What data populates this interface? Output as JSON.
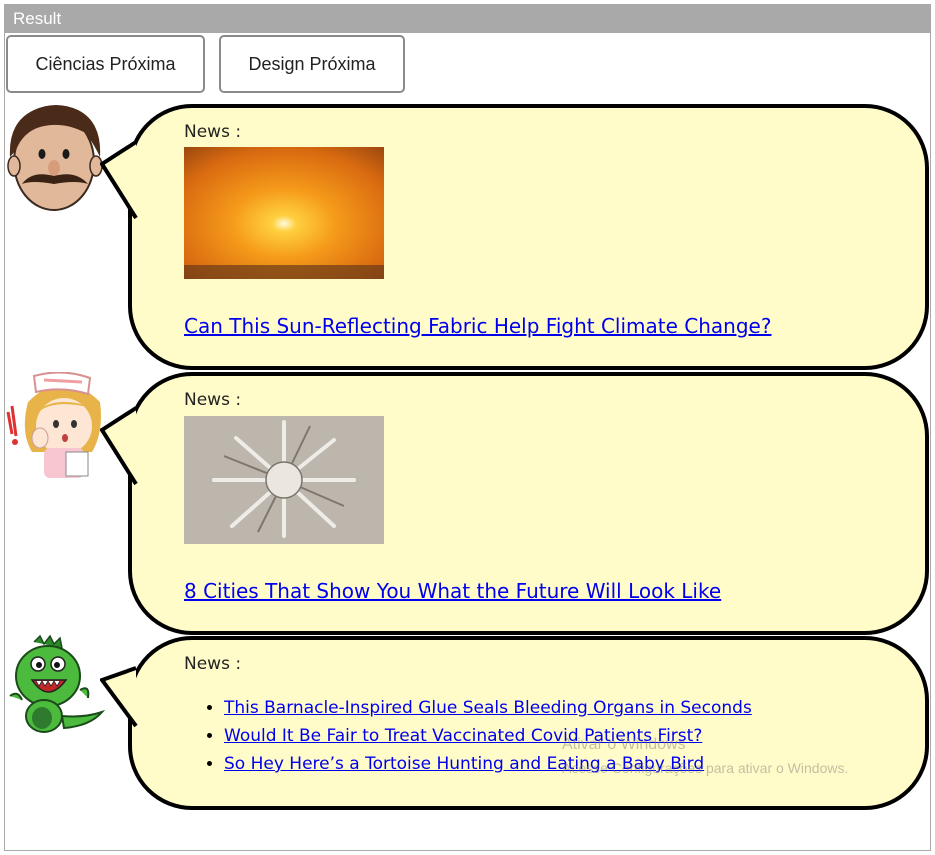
{
  "header": {
    "title": "Result"
  },
  "buttons": {
    "ciencias": "Ciências Próxima",
    "design": "Design Próxima"
  },
  "bubbles": [
    {
      "label": "News :",
      "image": "sunset-photo",
      "headline": "Can This Sun-Reflecting Fabric Help Fight Climate Change?"
    },
    {
      "label": "News :",
      "image": "futuristic-city-model-photo",
      "headline": "8 Cities That Show You What the Future Will Look Like"
    },
    {
      "label": "News :",
      "links": [
        "This Barnacle-Inspired Glue Seals Bleeding Organs in Seconds",
        "Would It Be Fair to Treat Vaccinated Covid Patients First?",
        "So Hey Here’s a Tortoise Hunting and Eating a Baby Bird"
      ]
    }
  ],
  "avatars": [
    "mustache-man-icon",
    "nurse-girl-icon",
    "green-dinosaur-icon"
  ],
  "watermark": {
    "line1": "Ativar o Windows",
    "line2": "Acesse Configurações para ativar o Windows."
  },
  "colors": {
    "bubble_fill": "#fffcc9",
    "header_bar": "#a9a9a9",
    "link": "#0000ee"
  }
}
